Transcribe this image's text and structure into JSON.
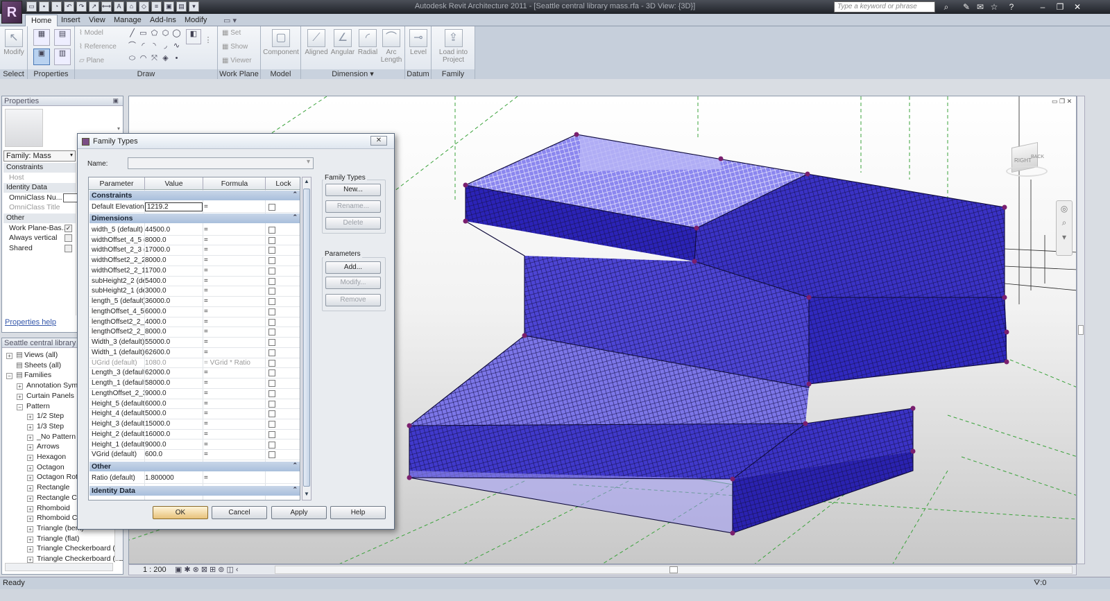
{
  "titlebar": {
    "window_title": "Autodesk Revit Architecture 2011 - [Seattle central library mass.rfa - 3D View: {3D}]",
    "search_placeholder": "Type a keyword or phrase",
    "logo_glyph": "R"
  },
  "ribbon": {
    "tabs": [
      "Home",
      "Insert",
      "View",
      "Manage",
      "Add-Ins",
      "Modify"
    ],
    "active_tab": "Home",
    "panels": {
      "select": "Select",
      "properties": "Properties",
      "draw": "Draw",
      "work_plane": "Work Plane",
      "model": "Model",
      "dimension": "Dimension",
      "datum": "Datum",
      "family_editor": "Family Editor"
    },
    "buttons": {
      "modify": "Modify",
      "model": "Model",
      "reference": "Reference",
      "plane": "Plane",
      "set": "Set",
      "show": "Show",
      "viewer": "Viewer",
      "component": "Component",
      "aligned": "Aligned",
      "angular": "Angular",
      "radial": "Radial",
      "arc_length_1": "Arc",
      "arc_length_2": "Length",
      "level": "Level",
      "load_into_project_1": "Load into",
      "load_into_project_2": "Project"
    }
  },
  "properties_panel": {
    "title": "Properties",
    "family_type": "Family: Mass",
    "rows": [
      {
        "label": "Constraints",
        "kind": "section"
      },
      {
        "label": "Host",
        "kind": "gray"
      },
      {
        "label": "Identity Data",
        "kind": "section"
      },
      {
        "label": "OmniClass Nu...",
        "kind": "normal"
      },
      {
        "label": "OmniClass Title",
        "kind": "gray"
      },
      {
        "label": "Other",
        "kind": "section"
      },
      {
        "label": "Work Plane-Bas...",
        "kind": "check",
        "checked": "✓"
      },
      {
        "label": "Always vertical",
        "kind": "check",
        "checked": ""
      },
      {
        "label": "Shared",
        "kind": "check",
        "checked": ""
      }
    ],
    "help_link": "Properties help"
  },
  "project_browser": {
    "title": "Seattle central library mass.rfa - Project Browser",
    "items": [
      {
        "label": "Views (all)",
        "depth": 0,
        "expander": "+"
      },
      {
        "label": "Sheets (all)",
        "depth": 0,
        "expander": ""
      },
      {
        "label": "Families",
        "depth": 0,
        "expander": "−"
      },
      {
        "label": "Annotation Symbols",
        "depth": 1,
        "expander": "+"
      },
      {
        "label": "Curtain Panels",
        "depth": 1,
        "expander": "+"
      },
      {
        "label": "Pattern",
        "depth": 1,
        "expander": "−"
      },
      {
        "label": "1/2 Step",
        "depth": 2,
        "expander": "+"
      },
      {
        "label": "1/3 Step",
        "depth": 2,
        "expander": "+"
      },
      {
        "label": "_No Pattern",
        "depth": 2,
        "expander": "+"
      },
      {
        "label": "Arrows",
        "depth": 2,
        "expander": "+"
      },
      {
        "label": "Hexagon",
        "depth": 2,
        "expander": "+"
      },
      {
        "label": "Octagon",
        "depth": 2,
        "expander": "+"
      },
      {
        "label": "Octagon Rotate",
        "depth": 2,
        "expander": "+"
      },
      {
        "label": "Rectangle",
        "depth": 2,
        "expander": "+"
      },
      {
        "label": "Rectangle Checkerboard",
        "depth": 2,
        "expander": "+"
      },
      {
        "label": "Rhomboid",
        "depth": 2,
        "expander": "+"
      },
      {
        "label": "Rhomboid Checkerboard",
        "depth": 2,
        "expander": "+"
      },
      {
        "label": "Triangle (bent)",
        "depth": 2,
        "expander": "+"
      },
      {
        "label": "Triangle (flat)",
        "depth": 2,
        "expander": "+"
      },
      {
        "label": "Triangle Checkerboard (bent)",
        "depth": 2,
        "expander": "+"
      },
      {
        "label": "Triangle Checkerboard (flat)",
        "depth": 2,
        "expander": "+"
      }
    ]
  },
  "dialog": {
    "title": "Family Types",
    "close_label": "✕",
    "name_label": "Name:",
    "name_value": "",
    "columns": [
      "Parameter",
      "Value",
      "Formula",
      "Lock"
    ],
    "groups": [
      {
        "label": "Constraints",
        "rows": [
          {
            "param": "Default Elevation",
            "value": "1219.2",
            "formula": "="
          }
        ]
      },
      {
        "label": "Dimensions",
        "rows": [
          {
            "param": "width_5 (default)",
            "value": "44500.0",
            "formula": "="
          },
          {
            "param": "widthOffset_4_5 (",
            "value": "8000.0",
            "formula": "="
          },
          {
            "param": "widthOffset_2_3 (",
            "value": "17000.0",
            "formula": "="
          },
          {
            "param": "widthOffset2_2_2",
            "value": "8000.0",
            "formula": "="
          },
          {
            "param": "widthOffset2_2_1",
            "value": "1700.0",
            "formula": "="
          },
          {
            "param": "subHeight2_2 (de",
            "value": "5400.0",
            "formula": "="
          },
          {
            "param": "subHeight2_1 (de",
            "value": "3000.0",
            "formula": "="
          },
          {
            "param": "length_5 (default)",
            "value": "36000.0",
            "formula": "="
          },
          {
            "param": "lengthOffset_4_5",
            "value": "6000.0",
            "formula": "="
          },
          {
            "param": "lengthOffset2_2_",
            "value": "4000.0",
            "formula": "="
          },
          {
            "param": "lengthOffset2_2_",
            "value": "8000.0",
            "formula": "="
          },
          {
            "param": "Width_3 (default)",
            "value": "55000.0",
            "formula": "="
          },
          {
            "param": "Width_1 (default)",
            "value": "62600.0",
            "formula": "="
          },
          {
            "param": "UGrid (default)",
            "value": "1080.0",
            "formula": "= VGrid * Ratio",
            "gray": true
          },
          {
            "param": "Length_3 (default",
            "value": "62000.0",
            "formula": "="
          },
          {
            "param": "Length_1 (default",
            "value": "58000.0",
            "formula": "="
          },
          {
            "param": "LengthOffset_2_3",
            "value": "9000.0",
            "formula": "="
          },
          {
            "param": "Height_5 (default",
            "value": "6000.0",
            "formula": "="
          },
          {
            "param": "Height_4 (default",
            "value": "5000.0",
            "formula": "="
          },
          {
            "param": "Height_3 (default",
            "value": "15000.0",
            "formula": "="
          },
          {
            "param": "Height_2 (default",
            "value": "16000.0",
            "formula": "="
          },
          {
            "param": "Height_1 (default",
            "value": "9000.0",
            "formula": "="
          },
          {
            "param": "VGrid (default)",
            "value": "600.0",
            "formula": "="
          }
        ]
      },
      {
        "label": "Other",
        "rows": [
          {
            "param": "Ratio (default)",
            "value": "1.800000",
            "formula": "="
          }
        ]
      },
      {
        "label": "Identity Data",
        "rows": []
      }
    ],
    "family_types_label": "Family Types",
    "family_type_buttons": [
      "New...",
      "Rename...",
      "Delete"
    ],
    "parameters_label": "Parameters",
    "parameter_buttons": [
      "Add...",
      "Modify...",
      "Remove"
    ],
    "bottom_buttons": [
      "OK",
      "Cancel",
      "Apply",
      "Help"
    ]
  },
  "view_bar": {
    "scale": "1 : 200"
  },
  "viewcube": {
    "face_left": "RIGHT",
    "face_right": "BACK"
  },
  "status_bar": {
    "text": "Ready",
    "filter_count": ":0"
  },
  "colors": {
    "mass_fill": "#3d35c8",
    "mass_light": "#8b86ef",
    "vertex": "#7a1f6e",
    "grid_line": "#2f9a2f"
  }
}
